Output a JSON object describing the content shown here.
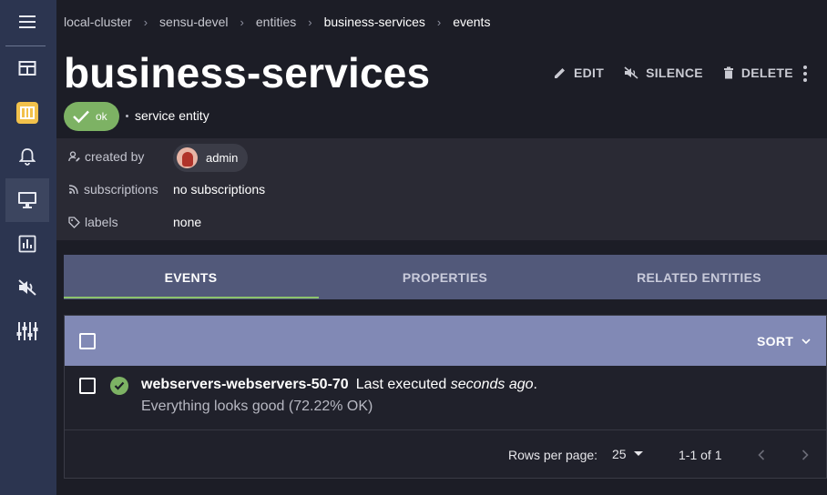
{
  "sidebar": {
    "items": [
      {
        "icon": "dashboard-icon"
      },
      {
        "icon": "sensu-logo-icon"
      },
      {
        "icon": "bell-icon"
      },
      {
        "icon": "monitor-icon",
        "active": true
      },
      {
        "icon": "bar-chart-icon"
      },
      {
        "icon": "silence-icon"
      },
      {
        "icon": "sliders-icon"
      }
    ]
  },
  "breadcrumb": {
    "items": [
      "local-cluster",
      "sensu-devel",
      "entities",
      "business-services",
      "events"
    ],
    "separator": "›"
  },
  "page": {
    "title": "business-services",
    "status": "ok",
    "entity_type": "service entity"
  },
  "actions": {
    "edit": "EDIT",
    "silence": "SILENCE",
    "delete": "DELETE"
  },
  "meta": {
    "created_by_label": "created by",
    "created_by_value": "admin",
    "subscriptions_label": "subscriptions",
    "subscriptions_value": "no subscriptions",
    "labels_label": "labels",
    "labels_value": "none"
  },
  "tabs": [
    {
      "label": "EVENTS",
      "active": true
    },
    {
      "label": "PROPERTIES",
      "active": false
    },
    {
      "label": "RELATED ENTITIES",
      "active": false
    }
  ],
  "events": {
    "sort_label": "SORT",
    "rows": [
      {
        "name": "webservers-webservers-50-70",
        "executed_prefix": "Last executed",
        "executed_ago": "seconds ago",
        "executed_suffix": ".",
        "output": "Everything looks good (72.22% OK)"
      }
    ]
  },
  "pagination": {
    "rows_per_page_label": "Rows per page:",
    "rows_per_page_value": "25",
    "range": "1-1 of 1"
  },
  "colors": {
    "sidebar": "#2c3550",
    "background": "#1c1d26",
    "tabs": "#52597a",
    "tab_indicator": "#8cc36c",
    "list_header": "#8189b5",
    "ok": "#7db264"
  }
}
